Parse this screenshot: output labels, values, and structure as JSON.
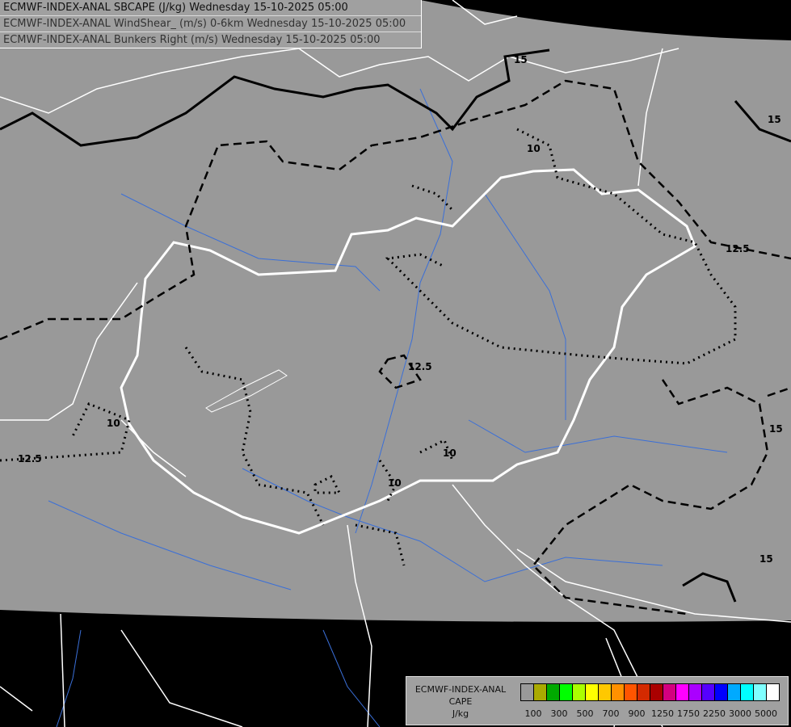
{
  "titles": [
    "ECMWF-INDEX-ANAL SBCAPE (J/kg) Wednesday 15-10-2025 05:00",
    "ECMWF-INDEX-ANAL WindShear_ (m/s) 0-6km Wednesday 15-10-2025 05:00",
    "ECMWF-INDEX-ANAL Bunkers Right (m/s) Wednesday 15-10-2025 05:00"
  ],
  "legend": {
    "line1": "ECMWF-INDEX-ANAL",
    "line2": "CAPE",
    "unit": "J/kg",
    "colors": [
      "#999999",
      "#aaaa00",
      "#00aa00",
      "#00ff00",
      "#aaff00",
      "#ffff00",
      "#ffc800",
      "#ff9100",
      "#ff5500",
      "#d42a00",
      "#aa0000",
      "#d4007f",
      "#ff00ff",
      "#aa00ff",
      "#5500ff",
      "#0000ff",
      "#00aaff",
      "#00ffff",
      "#80ffff",
      "#ffffff"
    ],
    "tick_labels": [
      "100",
      "300",
      "500",
      "700",
      "900",
      "1250",
      "1750",
      "2250",
      "3000",
      "5000"
    ]
  },
  "contour_labels": [
    "15",
    "15",
    "10",
    "12.5",
    "12.5",
    "10",
    "10",
    "10",
    "12.5",
    "15",
    "15"
  ],
  "colors": {
    "background": "#000000",
    "map_fill": "#999999",
    "borders": "#ffffff",
    "rivers": "#3a6fd8",
    "contours": "#000000"
  }
}
